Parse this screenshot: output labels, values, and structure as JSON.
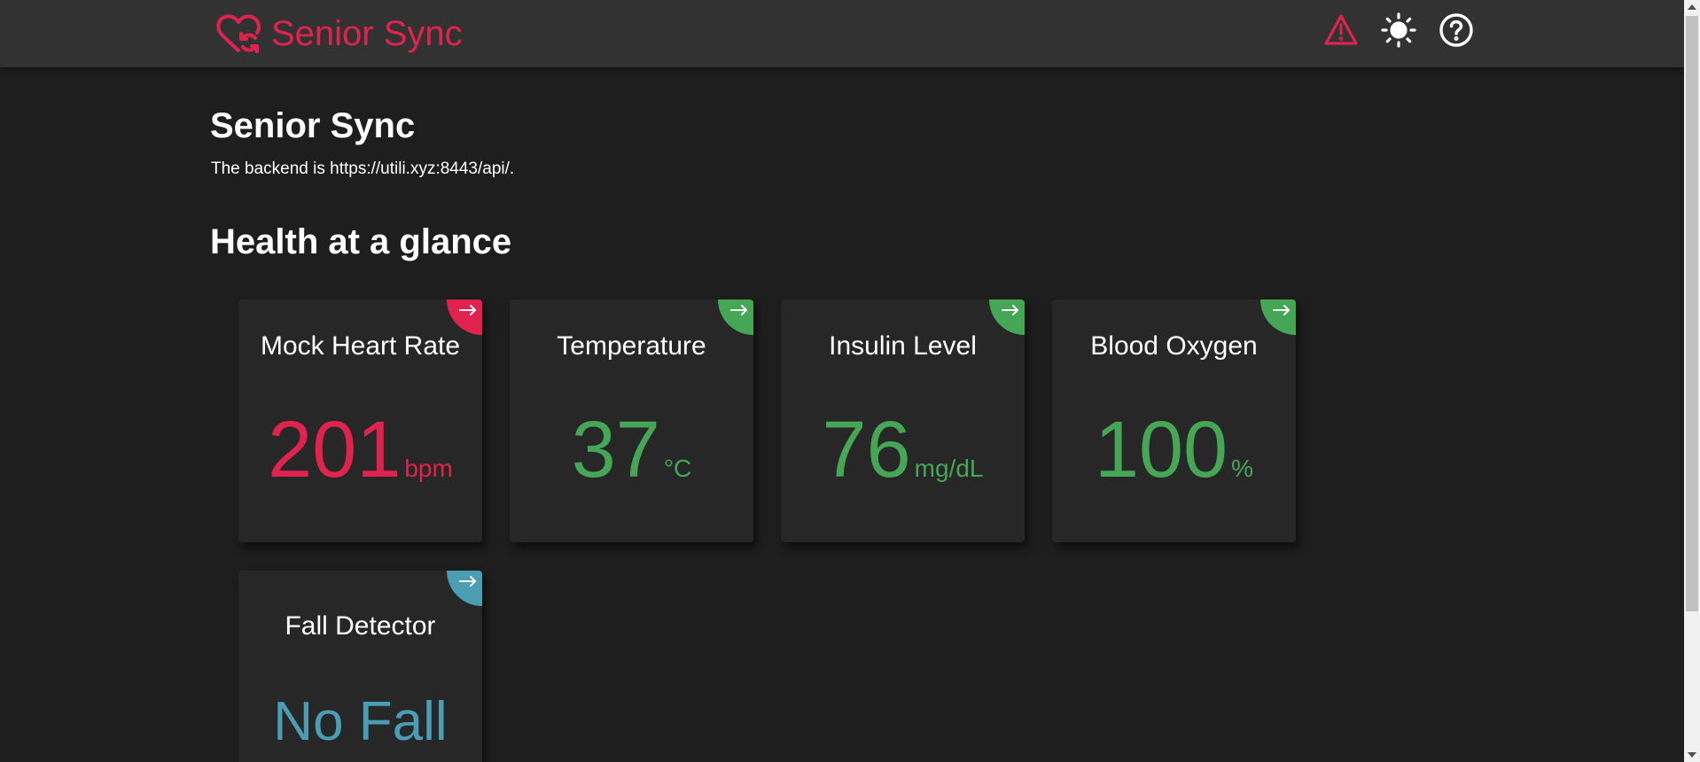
{
  "app": {
    "brand_name": "Senior Sync",
    "brand_icon": "heart-sync-icon",
    "brand_color": "#e0234e"
  },
  "header": {
    "icons": [
      {
        "name": "alert-triangle-icon",
        "color": "#e0234e"
      },
      {
        "name": "sun-icon",
        "color": "#ffffff"
      },
      {
        "name": "help-circle-icon",
        "color": "#ffffff"
      }
    ]
  },
  "main": {
    "title": "Senior Sync",
    "backend_text": "The backend is https://utili.xyz:8443/api/.",
    "section_title": "Health at a glance"
  },
  "cards": [
    {
      "title": "Mock Heart Rate",
      "value": "201",
      "unit": "bpm",
      "color": "#e0234e",
      "corner_icon": "arrow-right-icon"
    },
    {
      "title": "Temperature",
      "value": "37",
      "unit": "°C",
      "color": "#45a656",
      "corner_icon": "arrow-right-icon"
    },
    {
      "title": "Insulin Level",
      "value": "76",
      "unit": "mg/dL",
      "color": "#45a656",
      "corner_icon": "arrow-right-icon"
    },
    {
      "title": "Blood Oxygen",
      "value": "100",
      "unit": "%",
      "color": "#45a656",
      "corner_icon": "arrow-right-icon"
    },
    {
      "title": "Fall Detector",
      "value": "No Fall",
      "unit": "",
      "color": "#4a9db3",
      "corner_icon": "arrow-right-icon"
    }
  ]
}
